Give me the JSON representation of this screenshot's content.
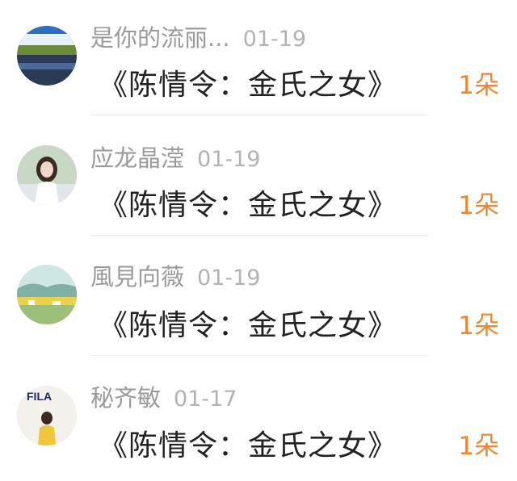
{
  "items": [
    {
      "name": "是你的流丽...",
      "date": "01-19",
      "title": "《陈情令：金氏之女》",
      "count": "1朵"
    },
    {
      "name": "应龙晶滢",
      "date": "01-19",
      "title": "《陈情令：金氏之女》",
      "count": "1朵"
    },
    {
      "name": "風見向薇",
      "date": "01-19",
      "title": "《陈情令：金氏之女》",
      "count": "1朵"
    },
    {
      "name": "秘齐敏",
      "date": "01-17",
      "title": "《陈情令：金氏之女》",
      "count": "1朵"
    }
  ],
  "avatar_logo_text": "FILA",
  "colors": {
    "count": "#f0862e",
    "name": "#9a9a9a",
    "title": "#222222",
    "divider": "#eeeeee"
  }
}
